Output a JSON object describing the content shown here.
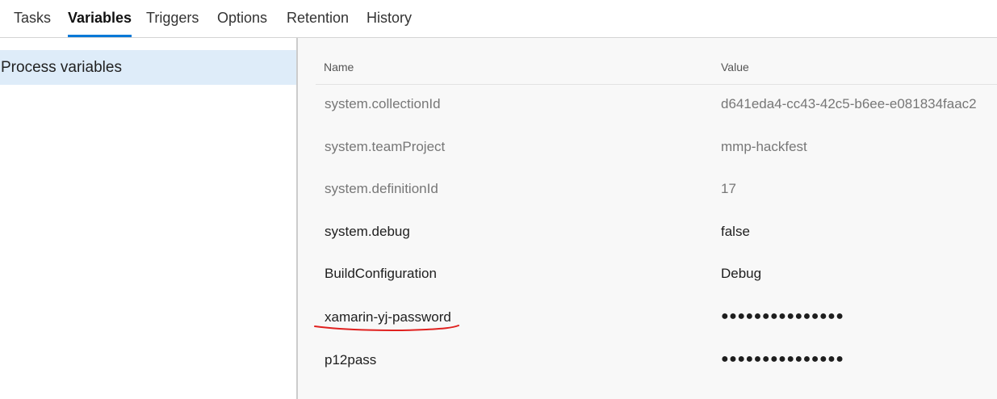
{
  "tabs": [
    {
      "label": "Tasks",
      "active": false
    },
    {
      "label": "Variables",
      "active": true
    },
    {
      "label": "Triggers",
      "active": false
    },
    {
      "label": "Options",
      "active": false
    },
    {
      "label": "Retention",
      "active": false
    },
    {
      "label": "History",
      "active": false
    }
  ],
  "sidebar": {
    "items": [
      {
        "label": "Process variables",
        "selected": true
      }
    ]
  },
  "grid": {
    "columns": {
      "name": "Name",
      "value": "Value"
    },
    "rows": [
      {
        "name": "system.collectionId",
        "value": "d641eda4-cc43-42c5-b6ee-e081834faac2",
        "kind": "system"
      },
      {
        "name": "system.teamProject",
        "value": "mmp-hackfest",
        "kind": "system"
      },
      {
        "name": "system.definitionId",
        "value": "17",
        "kind": "system"
      },
      {
        "name": "system.debug",
        "value": "false",
        "kind": "user"
      },
      {
        "name": "BuildConfiguration",
        "value": "Debug",
        "kind": "user"
      },
      {
        "name": "xamarin-yj-password",
        "value": "●●●●●●●●●●●●●●●",
        "kind": "user",
        "secret": true
      },
      {
        "name": "p12pass",
        "value": "●●●●●●●●●●●●●●●",
        "kind": "user",
        "secret": true
      }
    ]
  },
  "colors": {
    "accent": "#0078d7",
    "selected_bg": "#deecf9",
    "annotation": "#e0211f"
  }
}
